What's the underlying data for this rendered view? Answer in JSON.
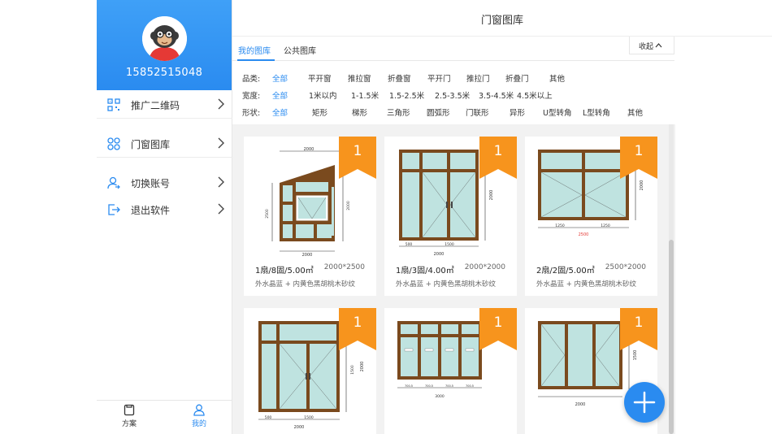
{
  "profile": {
    "phone": "15852515048"
  },
  "menu": [
    {
      "label": "推广二维码",
      "icon": "qr-code-icon"
    },
    {
      "label": "门窗图库",
      "icon": "gallery-icon"
    },
    {
      "label": "切换账号",
      "icon": "switch-account-icon"
    },
    {
      "label": "退出软件",
      "icon": "logout-icon"
    }
  ],
  "bottom_nav": [
    {
      "label": "方案",
      "icon": "plan-icon",
      "active": false
    },
    {
      "label": "我的",
      "icon": "user-icon",
      "active": true
    }
  ],
  "header": {
    "title": "门窗图库"
  },
  "tabs": [
    {
      "label": "我的图库",
      "active": true
    },
    {
      "label": "公共图库",
      "active": false
    }
  ],
  "collapse_label": "收起",
  "filters": {
    "category": {
      "label": "品类:",
      "options": [
        "全部",
        "平开窗",
        "推拉窗",
        "折叠窗",
        "平开门",
        "推拉门",
        "折叠门",
        "其他"
      ],
      "selected": "全部"
    },
    "width": {
      "label": "宽度:",
      "options": [
        "全部",
        "1米以内",
        "1-1.5米",
        "1.5-2.5米",
        "2.5-3.5米",
        "3.5-4.5米",
        "4.5米以上"
      ],
      "selected": "全部"
    },
    "shape": {
      "label": "形状:",
      "options": [
        "全部",
        "矩形",
        "梯形",
        "三角形",
        "圆弧形",
        "门联形",
        "异形",
        "U型转角",
        "L型转角",
        "其他"
      ],
      "selected": "全部"
    }
  },
  "cards": [
    {
      "badge": "1",
      "title": "1扇/8固/5.00㎡",
      "size": "2000*2500",
      "desc": "外水晶蓝 + 内黄色黑胡桃木砂纹"
    },
    {
      "badge": "1",
      "title": "1扇/3固/4.00㎡",
      "size": "2000*2000",
      "desc": "外水晶蓝 + 内黄色黑胡桃木砂纹"
    },
    {
      "badge": "1",
      "title": "2扇/2固/5.00㎡",
      "size": "2500*2000",
      "desc": "外水晶蓝 + 内黄色黑胡桃木砂纹"
    },
    {
      "badge": "1",
      "title": "",
      "size": "",
      "desc": ""
    },
    {
      "badge": "1",
      "title": "",
      "size": "",
      "desc": ""
    },
    {
      "badge": "1",
      "title": "",
      "size": "",
      "desc": ""
    }
  ],
  "drawing_dims": {
    "card1": [
      "2000",
      "2000",
      "1000",
      "2000",
      "2500"
    ],
    "card2": [
      "2000",
      "500",
      "1500",
      "2000"
    ],
    "card3": [
      "1250",
      "1250",
      "2500",
      "2000"
    ],
    "card4": [
      "2000",
      "1500",
      "500",
      "1500",
      "2000"
    ],
    "card5": [
      "700.5",
      "700.5",
      "700.5",
      "700.5",
      "3000"
    ],
    "card6": [
      "1500",
      "2000"
    ]
  },
  "colors": {
    "accent": "#2a8bf0",
    "ribbon": "#f7941d",
    "frame": "#7a4a1e",
    "glass": "#bfe3e0"
  }
}
